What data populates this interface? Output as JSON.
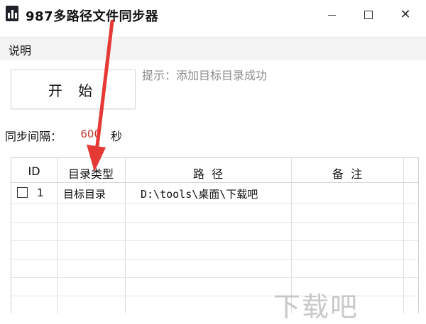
{
  "window": {
    "title": "987多路径文件同步器"
  },
  "menu": {
    "items": [
      "说明"
    ]
  },
  "controls": {
    "start_label": "开 始",
    "hint": "提示：添加目标目录成功",
    "interval_label": "同步间隔：",
    "interval_value": "600",
    "interval_unit": "秒"
  },
  "table": {
    "columns": [
      "ID",
      "目录类型",
      "路  径",
      "备  注"
    ],
    "rows": [
      {
        "checked": false,
        "id": "1",
        "type": "目标目录",
        "path": "D:\\tools\\桌面\\下载吧",
        "note": ""
      }
    ]
  },
  "watermark": "下载吧",
  "colors": {
    "annotation_arrow": "#e53935",
    "interval_value": "#c0392b"
  },
  "icons": {
    "app": "app-icon",
    "minimize": "minimize-icon",
    "maximize": "maximize-icon",
    "close": "close-icon"
  }
}
